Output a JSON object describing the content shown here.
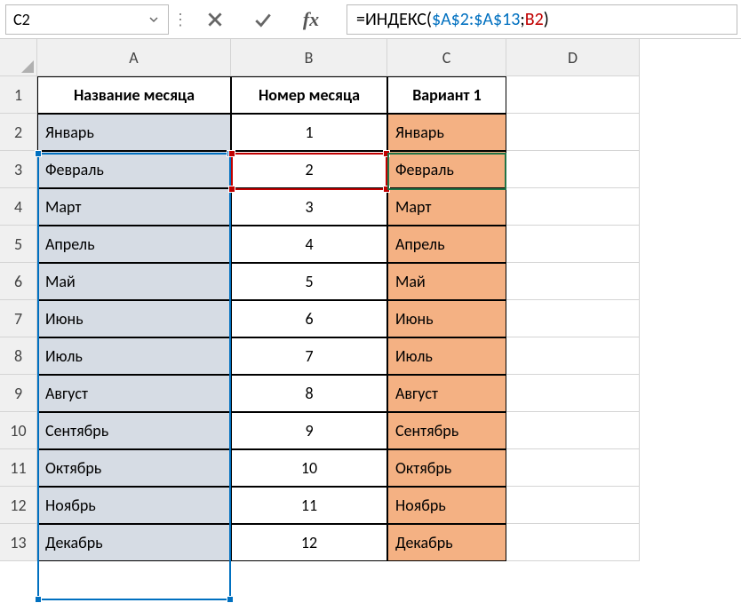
{
  "formula_bar": {
    "name_box": "C2",
    "formula_prefix": "=ИНДЕКС(",
    "ref_a": "$A$2:$A$13",
    "sep": ";",
    "ref_b": "B2",
    "suffix": ")"
  },
  "columns": [
    "A",
    "B",
    "C",
    "D"
  ],
  "rows": [
    "1",
    "2",
    "3",
    "4",
    "5",
    "6",
    "7",
    "8",
    "9",
    "10",
    "11",
    "12",
    "13"
  ],
  "headers": {
    "a": "Название месяца",
    "b": "Номер месяца",
    "c": "Вариант 1"
  },
  "data": [
    {
      "a": "Январь",
      "b": "1",
      "c": "Январь"
    },
    {
      "a": "Февраль",
      "b": "2",
      "c": "Февраль"
    },
    {
      "a": "Март",
      "b": "3",
      "c": "Март"
    },
    {
      "a": "Апрель",
      "b": "4",
      "c": "Апрель"
    },
    {
      "a": "Май",
      "b": "5",
      "c": "Май"
    },
    {
      "a": "Июнь",
      "b": "6",
      "c": "Июнь"
    },
    {
      "a": "Июль",
      "b": "7",
      "c": "Июль"
    },
    {
      "a": "Август",
      "b": "8",
      "c": "Август"
    },
    {
      "a": "Сентябрь",
      "b": "9",
      "c": "Сентябрь"
    },
    {
      "a": "Октябрь",
      "b": "10",
      "c": "Октябрь"
    },
    {
      "a": "Ноябрь",
      "b": "11",
      "c": "Ноябрь"
    },
    {
      "a": "Декабрь",
      "b": "12",
      "c": "Декабрь"
    }
  ]
}
